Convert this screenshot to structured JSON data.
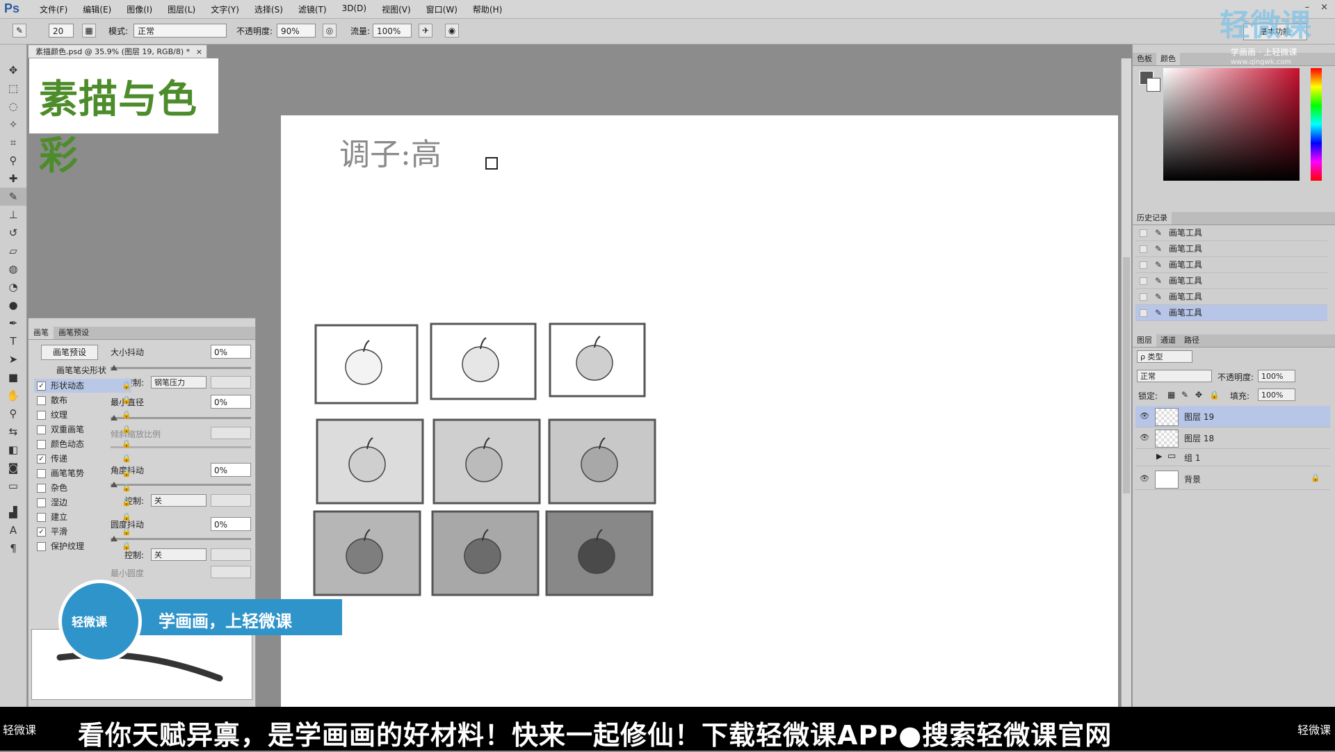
{
  "menubar": {
    "logo": "Ps",
    "items": [
      "文件(F)",
      "编辑(E)",
      "图像(I)",
      "图层(L)",
      "文字(Y)",
      "选择(S)",
      "滤镜(T)",
      "3D(D)",
      "视图(V)",
      "窗口(W)",
      "帮助(H)"
    ],
    "window_min": "–",
    "window_close": "×"
  },
  "options": {
    "brush_size": "20",
    "mode_label": "模式:",
    "mode_value": "正常",
    "opacity_label": "不透明度:",
    "opacity_value": "90%",
    "flow_label": "流量:",
    "flow_value": "100%",
    "workspace": "基本功能"
  },
  "document": {
    "tab_title": "素描颜色.psd @ 35.9% (图层 19, RGB/8) *",
    "tab_close": "×"
  },
  "logo_text": "素描与色彩",
  "brush_panel": {
    "tabs": [
      "画笔",
      "画笔预设"
    ],
    "preset_button": "画笔预设",
    "tip_shape": "画笔笔尖形状",
    "options": [
      {
        "label": "形状动态",
        "checked": true
      },
      {
        "label": "散布",
        "checked": false
      },
      {
        "label": "纹理",
        "checked": false
      },
      {
        "label": "双重画笔",
        "checked": false
      },
      {
        "label": "颜色动态",
        "checked": false
      },
      {
        "label": "传递",
        "checked": true
      },
      {
        "label": "画笔笔势",
        "checked": false
      },
      {
        "label": "杂色",
        "checked": false
      },
      {
        "label": "湿边",
        "checked": false
      },
      {
        "label": "建立",
        "checked": false
      },
      {
        "label": "平滑",
        "checked": true
      },
      {
        "label": "保护纹理",
        "checked": false
      }
    ],
    "size_jitter_label": "大小抖动",
    "size_jitter_value": "0%",
    "control_label": "控制:",
    "control_pen": "钢笔压力",
    "min_diameter_label": "最小直径",
    "min_diameter_value": "0%",
    "tilt_scale_label": "倾斜缩放比例",
    "angle_jitter_label": "角度抖动",
    "angle_jitter_value": "0%",
    "control_off": "关",
    "roundness_jitter_label": "圆度抖动",
    "roundness_jitter_value": "0%",
    "min_roundness_label": "最小圆度",
    "check_mark": "✓",
    "lock_glyph": "🔒"
  },
  "canvas": {
    "handwriting": "调子:高"
  },
  "color_panel": {
    "tabs": [
      "色板",
      "颜色"
    ]
  },
  "history_panel": {
    "title": "历史记录",
    "items": [
      "画笔工具",
      "画笔工具",
      "画笔工具",
      "画笔工具",
      "画笔工具",
      "画笔工具"
    ]
  },
  "layers_panel": {
    "tabs": [
      "图层",
      "通道",
      "路径"
    ],
    "filter": "ρ 类型",
    "blend_mode": "正常",
    "opacity_label": "不透明度:",
    "opacity_value": "100%",
    "lock_label": "锁定:",
    "fill_label": "填充:",
    "fill_value": "100%",
    "layers": [
      {
        "name": "图层 19",
        "visible": true,
        "active": true
      },
      {
        "name": "图层 18",
        "visible": true,
        "active": false
      },
      {
        "name": "组 1",
        "visible": false,
        "active": false
      },
      {
        "name": "背景",
        "visible": true,
        "active": false
      }
    ]
  },
  "watermark": {
    "brand": "轻微课",
    "slogan": "学画画 · 上轻微课",
    "url": "www.qingwk.com"
  },
  "ad": {
    "circle_text": "轻微课",
    "banner_text": "学画画，上轻微课",
    "bottom_message": "看你天赋异禀，是学画画的好材料！快来一起修仙！下载轻微课APP●搜索轻微课官网",
    "bottom_left": "轻微课",
    "bottom_right": "轻微课"
  }
}
